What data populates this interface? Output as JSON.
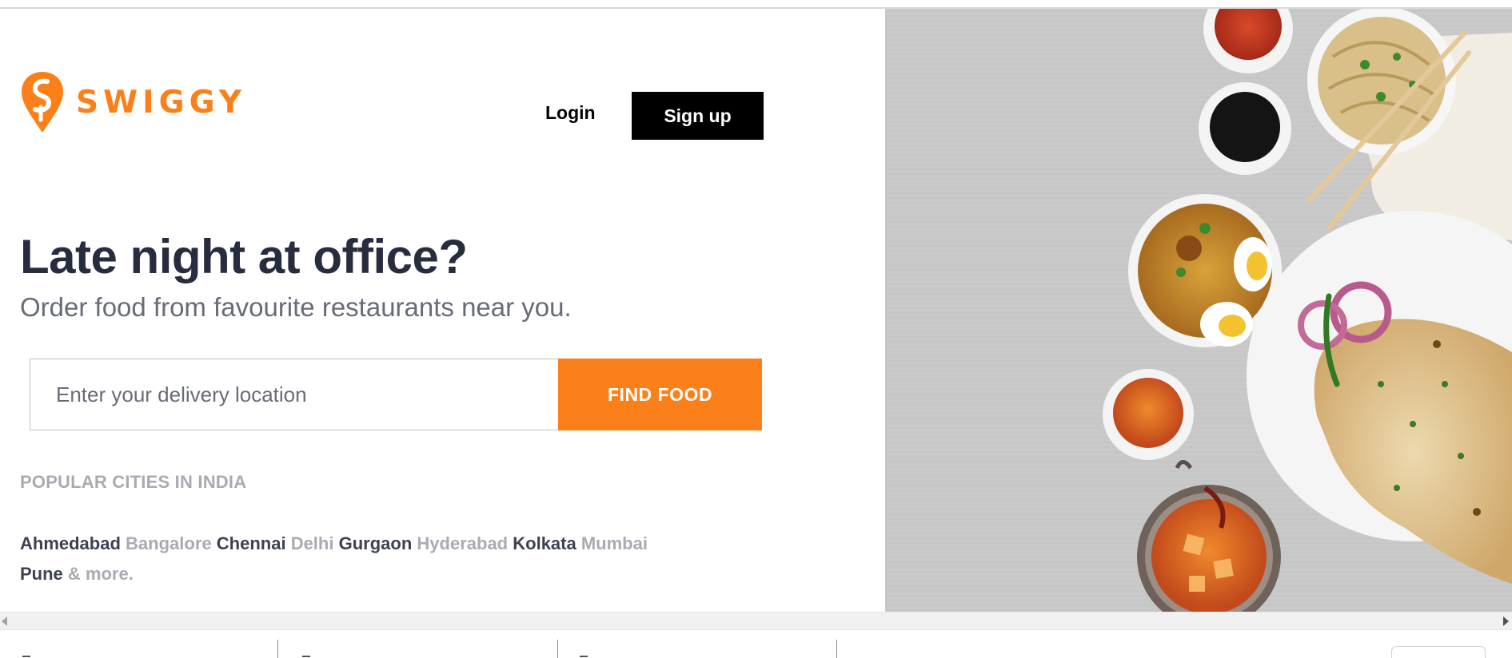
{
  "brand": {
    "name": "SWIGGY",
    "accent_color": "#fc8019"
  },
  "header": {
    "login_label": "Login",
    "signup_label": "Sign up"
  },
  "hero": {
    "headline": "Late night at office?",
    "subheadline": "Order food from favourite restaurants near you."
  },
  "search": {
    "placeholder": "Enter your delivery location",
    "value": "",
    "button_label": "FIND FOOD"
  },
  "cities": {
    "heading": "POPULAR CITIES IN INDIA",
    "items": [
      {
        "name": "Ahmedabad",
        "tone": "dark"
      },
      {
        "name": "Bangalore",
        "tone": "light"
      },
      {
        "name": "Chennai",
        "tone": "dark"
      },
      {
        "name": "Delhi",
        "tone": "light"
      },
      {
        "name": "Gurgaon",
        "tone": "dark"
      },
      {
        "name": "Hyderabad",
        "tone": "light"
      },
      {
        "name": "Kolkata",
        "tone": "dark"
      },
      {
        "name": "Mumbai",
        "tone": "light"
      },
      {
        "name": "Pune",
        "tone": "dark"
      }
    ],
    "more_label": "& more."
  },
  "hero_image": {
    "icon": "food-platter-image"
  }
}
